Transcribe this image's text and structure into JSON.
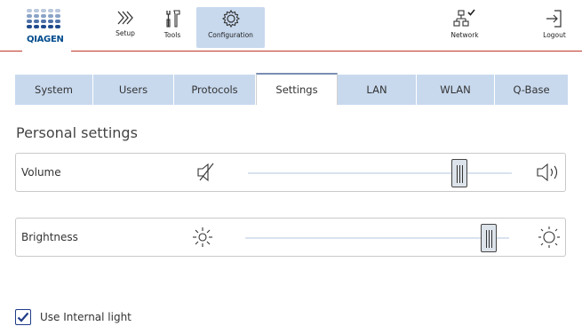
{
  "header": {
    "brand": "QIAGEN",
    "buttons": {
      "setup": "Setup",
      "tools": "Tools",
      "configuration": "Configuration",
      "network": "Network",
      "logout": "Logout"
    }
  },
  "tabs": [
    {
      "label": "System"
    },
    {
      "label": "Users"
    },
    {
      "label": "Protocols"
    },
    {
      "label": "Settings",
      "active": true
    },
    {
      "label": "LAN"
    },
    {
      "label": "WLAN"
    },
    {
      "label": "Q-Base"
    }
  ],
  "personal_settings": {
    "title": "Personal settings",
    "volume": {
      "label": "Volume",
      "level": 0.82
    },
    "brightness": {
      "label": "Brightness",
      "level": 0.95
    }
  },
  "internal_light": {
    "label": "Use Internal light",
    "checked": true
  },
  "colors": {
    "accent": "#c8d9ee",
    "brand_blue": "#004b8d",
    "brand_red": "#c0392b"
  },
  "icons": {
    "setup": "chevrons-right-icon",
    "tools": "tools-icon",
    "configuration": "gear-icon",
    "network": "network-icon",
    "logout": "logout-icon",
    "volume_mute": "speaker-mute-icon",
    "volume_high": "speaker-high-icon",
    "brightness_low": "sun-low-icon",
    "brightness_high": "sun-high-icon"
  }
}
